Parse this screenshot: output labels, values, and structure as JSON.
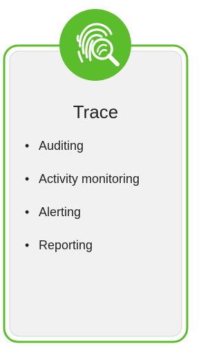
{
  "card": {
    "title": "Trace",
    "bullet_glyph": "•",
    "items": [
      {
        "label": "Auditing"
      },
      {
        "label": "Activity monitoring"
      },
      {
        "label": "Alerting"
      },
      {
        "label": "Reporting"
      }
    ]
  },
  "icon": {
    "name": "fingerprint-magnifier-icon"
  },
  "colors": {
    "accent_green": "#5bbd2b",
    "card_fill": "#f1f1f1",
    "text": "#222222",
    "icon_fg": "#ffffff"
  }
}
